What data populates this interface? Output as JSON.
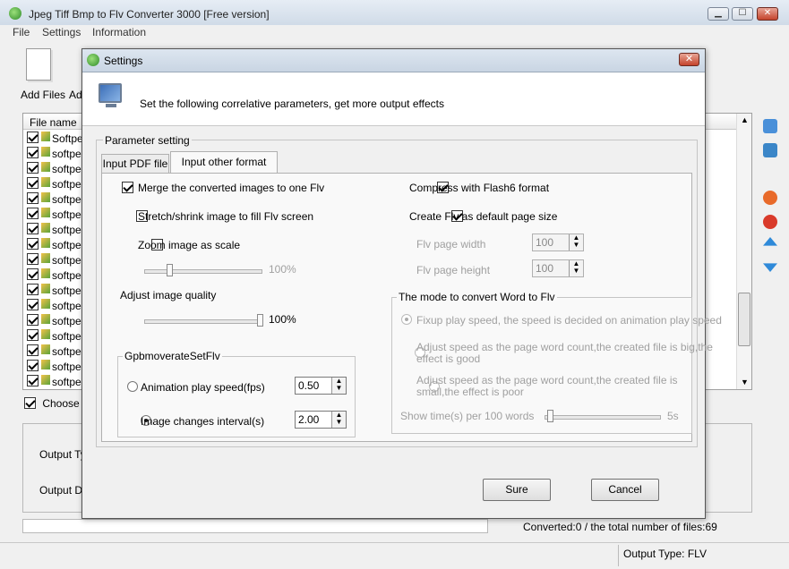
{
  "window": {
    "title": "Jpeg Tiff Bmp to Flv Converter 3000 [Free version]"
  },
  "menu": [
    "File",
    "Settings",
    "Information"
  ],
  "toolbar": {
    "add_files": "Add Files",
    "add_folder_partial": "Ad"
  },
  "file_list": {
    "header": "File name",
    "rows": [
      "Softpe",
      "softpe",
      "softpe",
      "softpe",
      "softpe",
      "softpe",
      "softpe",
      "softpe",
      "softpe",
      "softpe",
      "softpe",
      "softpe",
      "softpe",
      "softpe",
      "softpe",
      "softpe",
      "softpe"
    ]
  },
  "choose_all": "Choose a",
  "output": {
    "type_label": "Output Ty",
    "dir_label": "Output Di"
  },
  "status": {
    "converted": "Converted:0  /  the total number of files:69",
    "output_type": "Output Type: FLV"
  },
  "dialog": {
    "title": "Settings",
    "header_text": "Set the following correlative parameters, get more output effects",
    "group_label": "Parameter setting",
    "tabs": [
      "Input PDF file",
      "Input other format files"
    ],
    "left": {
      "merge": {
        "label": "Merge the converted images to one Flv",
        "checked": true
      },
      "stretch": {
        "label": "Stretch/shrink image to fill Flv screen",
        "checked": false
      },
      "zoom": {
        "label": "Zoom image as scale",
        "checked": false
      },
      "zoom_value": "100%",
      "quality_label": "Adjust image quality",
      "quality_value": "100%",
      "gpb_group": "GpbmoverateSetFlv",
      "anim_speed": {
        "label": "Animation play speed(fps)",
        "value": "0.50",
        "selected": false
      },
      "img_interval": {
        "label": "Image changes interval(s)",
        "value": "2.00",
        "selected": true
      }
    },
    "right": {
      "compress": {
        "label": "Compress with Flash6 format",
        "checked": true
      },
      "default_size": {
        "label": "Create Flv as default page size",
        "checked": true
      },
      "width": {
        "label": "Flv page width",
        "value": "100"
      },
      "height": {
        "label": "Flv page height",
        "value": "100"
      },
      "word_group": "The mode to convert Word to Flv",
      "mode1": "Fixup play speed, the speed is decided on animation play speed",
      "mode2_line1": "Adjust speed as the page word count,the created file is big,the",
      "mode2_line2": "effect is good",
      "mode3_line1": "Adjust speed as the page word count,the created file is",
      "mode3_line2": "small,the effect is poor",
      "show_time": "Show time(s) per 100 words",
      "show_time_value": "5s"
    },
    "buttons": {
      "ok": "Sure",
      "cancel": "Cancel"
    }
  }
}
